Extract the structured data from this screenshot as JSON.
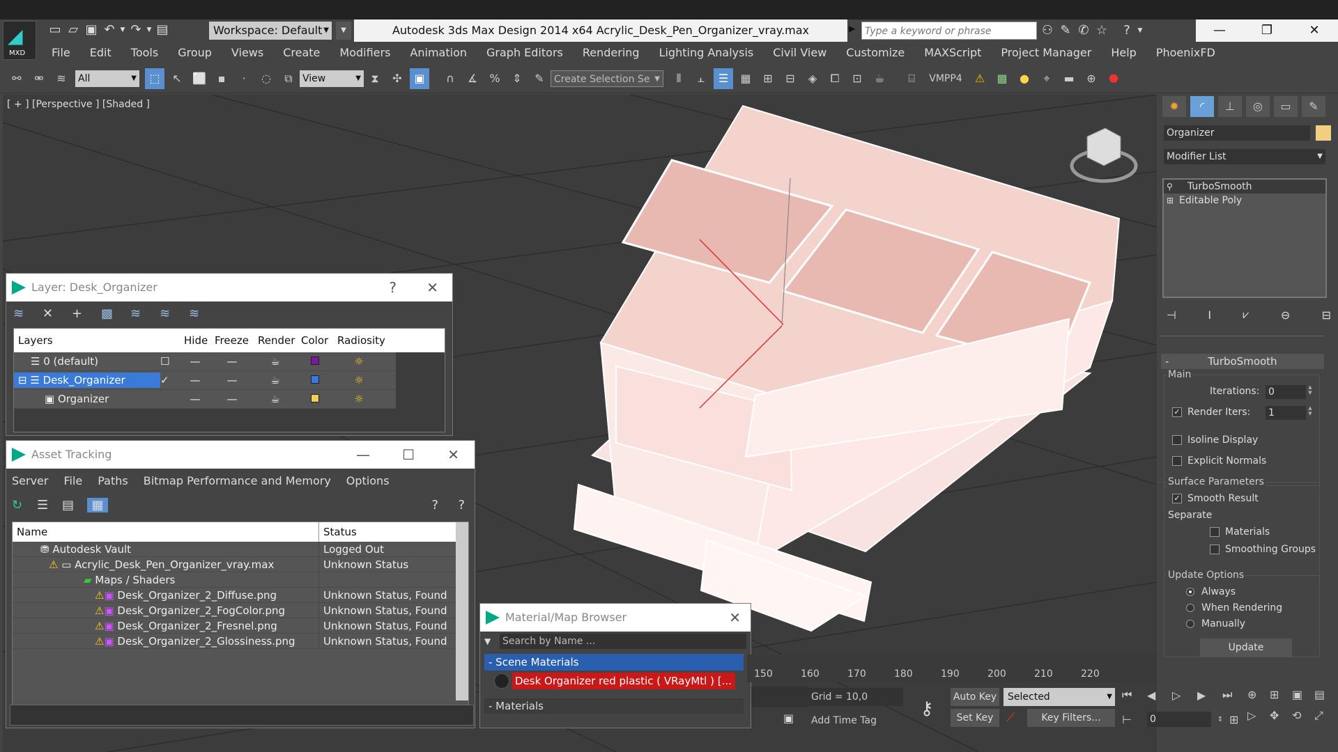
{
  "app": {
    "logo_text": "MXD",
    "title": "Autodesk 3ds Max Design 2014 x64      Acrylic_Desk_Pen_Organizer_vray.max",
    "workspace": "Workspace: Default",
    "search_placeholder": "Type a keyword or phrase"
  },
  "menubar": [
    "File",
    "Edit",
    "Tools",
    "Group",
    "Views",
    "Create",
    "Modifiers",
    "Animation",
    "Graph Editors",
    "Rendering",
    "Lighting Analysis",
    "Civil View",
    "Customize",
    "MAXScript",
    "Project Manager",
    "Help",
    "PhoenixFD"
  ],
  "toolbar": {
    "filter": "All",
    "refcoord": "View",
    "selection_set": "Create Selection Se",
    "vmpp": "VMPP4"
  },
  "viewport": {
    "label": "[ + ] [Perspective ] [Shaded ]"
  },
  "cmdpanel": {
    "object_name": "Organizer",
    "object_color": "#f0d080",
    "modifier_list": "Modifier List",
    "stack": [
      "TurboSmooth",
      "Editable Poly"
    ],
    "rollout_title": "TurboSmooth",
    "main_label": "Main",
    "iterations_label": "Iterations:",
    "iterations": "0",
    "render_iters_label": "Render Iters:",
    "render_iters": "1",
    "render_iters_checked": true,
    "isoline": "Isoline Display",
    "explicit": "Explicit Normals",
    "surface_params": "Surface Parameters",
    "smooth_result": "Smooth Result",
    "separate": "Separate",
    "materials": "Materials",
    "smoothing_groups": "Smoothing Groups",
    "update_options": "Update Options",
    "always": "Always",
    "when_rendering": "When Rendering",
    "manually": "Manually",
    "update_btn": "Update"
  },
  "layer_dialog": {
    "title": "Layer: Desk_Organizer",
    "help": "?",
    "columns": [
      "Layers",
      "Hide",
      "Freeze",
      "Render",
      "Color",
      "Radiosity"
    ],
    "rows": [
      {
        "name": "0 (default)",
        "color": "#7a1aa0"
      },
      {
        "name": "Desk_Organizer",
        "color": "#3a7ae0"
      },
      {
        "name": "Organizer",
        "color": "#f0d050"
      }
    ]
  },
  "asset_dialog": {
    "title": "Asset Tracking",
    "menu": [
      "Server",
      "File",
      "Paths",
      "Bitmap Performance and Memory",
      "Options"
    ],
    "columns": [
      "Name",
      "Status"
    ],
    "rows": [
      {
        "name": "Autodesk Vault",
        "status": "Logged Out"
      },
      {
        "name": "Acrylic_Desk_Pen_Organizer_vray.max",
        "status": "Unknown Status"
      },
      {
        "name": "Maps / Shaders",
        "status": ""
      },
      {
        "name": "Desk_Organizer_2_Diffuse.png",
        "status": "Unknown Status, Found"
      },
      {
        "name": "Desk_Organizer_2_FogColor.png",
        "status": "Unknown Status, Found"
      },
      {
        "name": "Desk_Organizer_2_Fresnel.png",
        "status": "Unknown Status, Found"
      },
      {
        "name": "Desk_Organizer_2_Glossiness.png",
        "status": "Unknown Status, Found"
      }
    ]
  },
  "material_browser": {
    "title": "Material/Map Browser",
    "search_placeholder": "Search by Name ...",
    "scene_materials": "- Scene Materials",
    "material_item": "Desk Organizer red plastic  ( VRayMtl )  [...",
    "materials": "- Materials"
  },
  "timeline": {
    "ticks": [
      "150",
      "160",
      "170",
      "180",
      "190",
      "200",
      "210",
      "220"
    ]
  },
  "statusbar": {
    "grid": "Grid = 10,0",
    "add_time_tag": "Add Time Tag",
    "auto_key": "Auto Key",
    "set_key": "Set Key",
    "key_mode": "Selected",
    "key_filters": "Key Filters...",
    "frame": "0"
  }
}
